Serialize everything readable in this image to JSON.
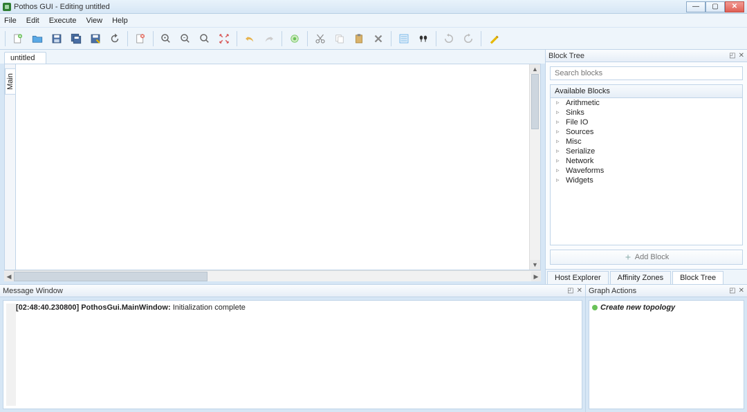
{
  "window": {
    "title": "Pothos GUI - Editing untitled"
  },
  "menu": {
    "file": "File",
    "edit": "Edit",
    "execute": "Execute",
    "view": "View",
    "help": "Help"
  },
  "toolbar_icons": {
    "new": "new-file-icon",
    "open": "open-file-icon",
    "save": "save-icon",
    "save_all": "save-all-icon",
    "save_as": "save-as-icon",
    "reload": "reload-icon",
    "close": "close-icon",
    "zoom_in": "zoom-in-icon",
    "zoom_out": "zoom-out-icon",
    "zoom_orig": "zoom-orig-icon",
    "fit": "fit-icon",
    "undo": "undo-icon",
    "redo": "redo-icon",
    "activate": "activate-icon",
    "cut": "cut-icon",
    "copy": "copy-icon",
    "paste": "paste-icon",
    "delete": "delete-icon",
    "select_all": "select-all-icon",
    "find": "find-icon",
    "rotate_left": "rotate-left-icon",
    "rotate_right": "rotate-right-icon",
    "properties": "properties-icon"
  },
  "tabs": {
    "document": "untitled",
    "canvas_tab": "Main"
  },
  "block_tree": {
    "title": "Block Tree",
    "search_placeholder": "Search blocks",
    "available_header": "Available Blocks",
    "categories": [
      "Arithmetic",
      "Sinks",
      "File IO",
      "Sources",
      "Misc",
      "Serialize",
      "Network",
      "Waveforms",
      "Widgets"
    ],
    "add_button": "Add Block",
    "bottom_tabs": [
      "Host Explorer",
      "Affinity Zones",
      "Block Tree"
    ],
    "active_bottom_tab": 2
  },
  "message_window": {
    "title": "Message Window",
    "timestamp": "[02:48:40.230800]",
    "source": "PothosGui.MainWindow:",
    "text": "Initialization complete"
  },
  "graph_actions": {
    "title": "Graph Actions",
    "item": "Create new topology"
  }
}
